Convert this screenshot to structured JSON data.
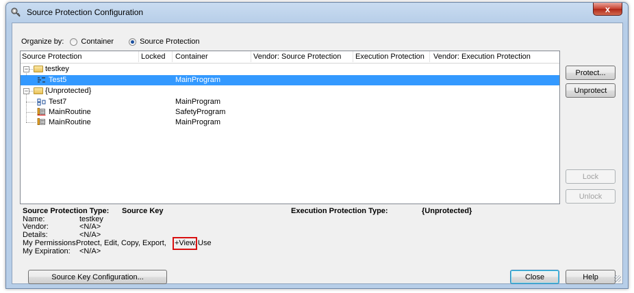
{
  "window": {
    "title": "Source Protection Configuration",
    "close_glyph": "x"
  },
  "organize": {
    "label": "Organize by:",
    "options": [
      {
        "label": "Container",
        "selected": false
      },
      {
        "label": "Source Protection",
        "selected": true
      }
    ]
  },
  "columns": [
    "Source Protection",
    "Locked",
    "Container",
    "Vendor: Source Protection",
    "Execution Protection",
    "Vendor: Execution Protection"
  ],
  "rows": [
    {
      "name": "testkey",
      "container": "",
      "level": 0,
      "type": "folder",
      "selected": false
    },
    {
      "name": "Test5",
      "container": "MainProgram",
      "level": 1,
      "type": "routine",
      "selected": true
    },
    {
      "name": "{Unprotected}",
      "container": "",
      "level": 0,
      "type": "folder",
      "selected": false
    },
    {
      "name": "Test7",
      "container": "MainProgram",
      "level": 1,
      "type": "fbd",
      "selected": false
    },
    {
      "name": "MainRoutine",
      "container": "SafetyProgram",
      "level": 1,
      "type": "ladder-safety",
      "selected": false
    },
    {
      "name": "MainRoutine",
      "container": "MainProgram",
      "level": 1,
      "type": "ladder",
      "selected": false
    }
  ],
  "details": {
    "sp_type_label": "Source Protection Type:",
    "sp_type_value": "Source Key",
    "ep_type_label": "Execution Protection Type:",
    "ep_type_value": "{Unprotected}",
    "name_label": "Name:",
    "name_value": "testkey",
    "vendor_label": "Vendor:",
    "vendor_value": "<N/A>",
    "details_label": "Details:",
    "details_value": "<N/A>",
    "permissions_label": "My Permissions:",
    "permissions_prefix": "Protect, Edit, Copy, Export,",
    "permissions_highlight": "+View,",
    "permissions_suffix": "Use",
    "expiration_label": "My Expiration:",
    "expiration_value": "<N/A>"
  },
  "buttons": {
    "protect": "Protect...",
    "unprotect": "Unprotect",
    "lock": "Lock",
    "unlock": "Unlock",
    "source_key_config": "Source Key Configuration...",
    "close": "Close",
    "help": "Help"
  },
  "colors": {
    "selection": "#3399ff",
    "highlight_box": "#d81010"
  }
}
